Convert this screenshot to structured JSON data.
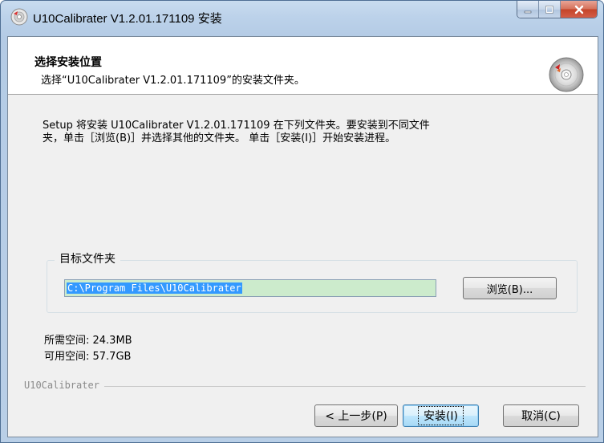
{
  "window": {
    "title": "U10Calibrater V1.2.01.171109 安装"
  },
  "header": {
    "title": "选择安装位置",
    "subtitle": "选择“U10Calibrater V1.2.01.171109”的安装文件夹。"
  },
  "description": "Setup 将安装 U10Calibrater V1.2.01.171109 在下列文件夹。要安装到不同文件\n夹，单击［浏览(B)］并选择其他的文件夹。 单击［安装(I)］开始安装进程。",
  "destination": {
    "group_label": "目标文件夹",
    "path_value": "C:\\Program Files\\U10Calibrater",
    "browse_label": "浏览(B)..."
  },
  "space": {
    "required": "所需空间: 24.3MB",
    "available": "可用空间: 57.7GB"
  },
  "branding": "U10Calibrater",
  "buttons": {
    "back": "< 上一步(P)",
    "install": "安装(I)",
    "cancel": "取消(C)"
  },
  "colors": {
    "path_highlight": "#3399ff",
    "path_field_bg": "#ccebcc",
    "close_button": "#c4442a"
  },
  "icons": {
    "app": "installer-disc-icon",
    "header": "cd-disc-icon"
  }
}
